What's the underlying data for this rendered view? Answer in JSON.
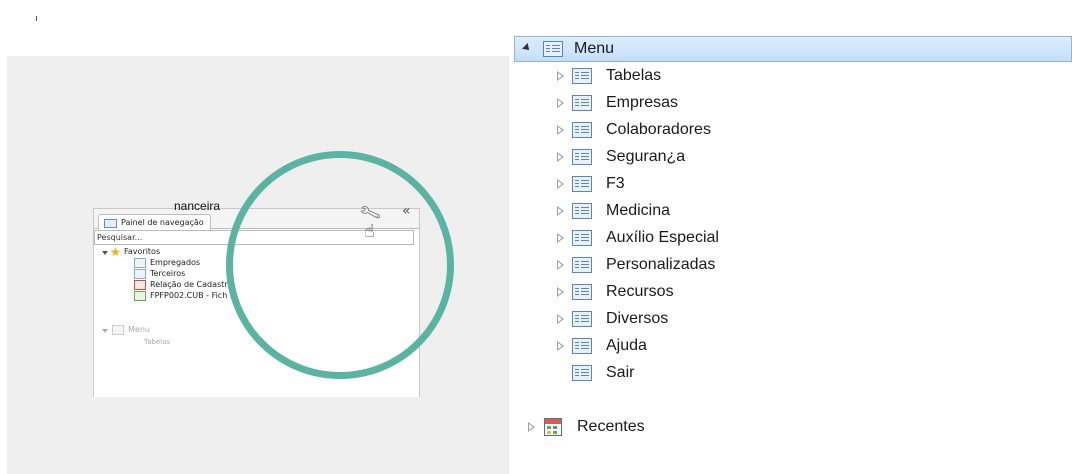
{
  "illustration": {
    "panel_tab_label": "Painel de navegação",
    "search_placeholder": "Pesquisar...",
    "favorites": {
      "label": "Favoritos",
      "items": [
        "Empregados",
        "Terceiros",
        "Relação de Cadastr",
        "FPFP002.CUB - Fich"
      ]
    },
    "menu_label": "Menu",
    "menu_first_child": "Tabelas",
    "partial_text": "nanceira",
    "accent_color": "#5bb3a3"
  },
  "tree": {
    "root": {
      "label": "Menu",
      "expanded": true,
      "selected": true
    },
    "items": [
      {
        "label": "Tabelas"
      },
      {
        "label": "Empresas"
      },
      {
        "label": "Colaboradores"
      },
      {
        "label": "Seguran¿a"
      },
      {
        "label": "F3"
      },
      {
        "label": "Medicina"
      },
      {
        "label": "Auxílio Especial"
      },
      {
        "label": "Personalizadas"
      },
      {
        "label": "Recursos"
      },
      {
        "label": "Diversos"
      },
      {
        "label": "Ajuda"
      },
      {
        "label": "Sair"
      }
    ],
    "recent": {
      "label": "Recentes"
    }
  }
}
